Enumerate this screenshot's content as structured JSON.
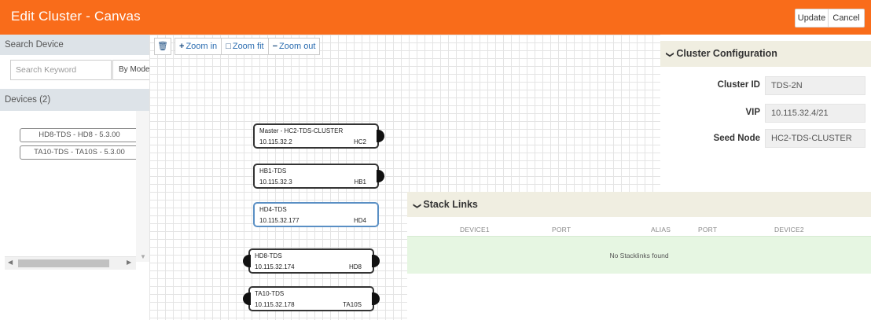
{
  "header": {
    "title": "Edit Cluster - Canvas",
    "update_label": "Update",
    "cancel_label": "Cancel",
    "bg_color": "#f96c1a"
  },
  "sidebar": {
    "search_title": "Search Device",
    "search_placeholder": "Search Keyword",
    "by_model_label": "By Model",
    "devices_title": "Devices (2)",
    "devices": [
      {
        "label": "HD8-TDS - HD8 - 5.3.00"
      },
      {
        "label": "TA10-TDS - TA10S - 5.3.00"
      }
    ]
  },
  "toolbar": {
    "trash_icon": "trash-icon",
    "zoom_in_label": "Zoom in",
    "zoom_fit_label": "Zoom fit",
    "zoom_out_label": "Zoom out"
  },
  "canvas": {
    "nodes": [
      {
        "name": "Master - HC2-TDS-CLUSTER",
        "ip": "10.115.32.2",
        "model": "HC2",
        "selected": false
      },
      {
        "name": "HB1-TDS",
        "ip": "10.115.32.3",
        "model": "HB1",
        "selected": false
      },
      {
        "name": "HD4-TDS",
        "ip": "10.115.32.177",
        "model": "HD4",
        "selected": true
      },
      {
        "name": "HD8-TDS",
        "ip": "10.115.32.174",
        "model": "HD8",
        "selected": false
      },
      {
        "name": "TA10-TDS",
        "ip": "10.115.32.178",
        "model": "TA10S",
        "selected": false
      }
    ]
  },
  "cluster_config": {
    "title": "Cluster Configuration",
    "fields": [
      {
        "label": "Cluster ID",
        "value": "TDS-2N"
      },
      {
        "label": "VIP",
        "value": "10.115.32.4/21"
      },
      {
        "label": "Seed Node",
        "value": "HC2-TDS-CLUSTER"
      }
    ]
  },
  "stack_links": {
    "title": "Stack Links",
    "columns": [
      "DEVICE1",
      "PORT",
      "ALIAS",
      "PORT",
      "DEVICE2"
    ],
    "empty_text": "No Stacklinks found"
  }
}
